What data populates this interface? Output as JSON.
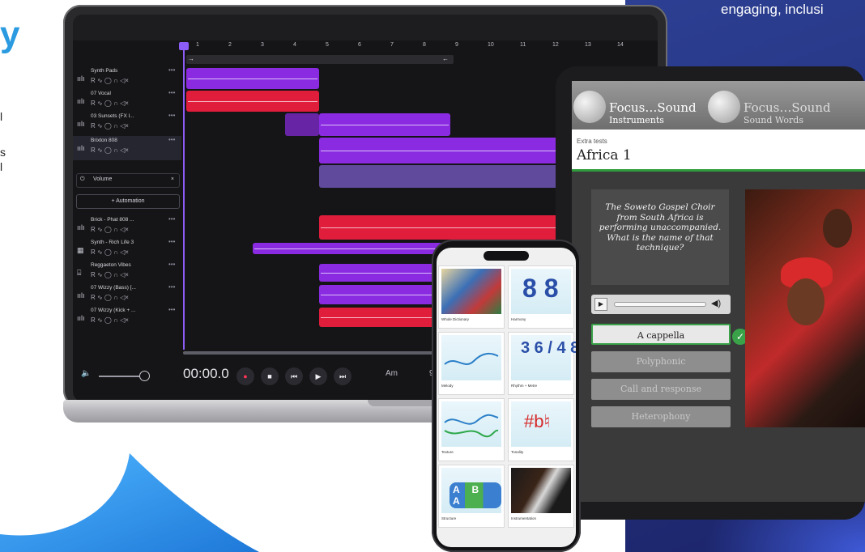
{
  "page": {
    "tagline": "engaging, inclusi",
    "headline_fragment": "y",
    "left_text_fragments": [
      "l",
      "s",
      "l"
    ],
    "colors": {
      "accent_blue": "#2a9be0",
      "panel_blue": "#2c3f92",
      "purple_clip": "#8a2be2",
      "red_clip": "#e11d3c",
      "correct_green": "#3aa34a"
    }
  },
  "daw": {
    "ruler": [
      "1",
      "2",
      "3",
      "4",
      "5",
      "6",
      "7",
      "8",
      "9",
      "10",
      "11",
      "12",
      "13",
      "14"
    ],
    "loop_arrows": {
      "start": "→",
      "end": "←"
    },
    "tracks": [
      {
        "name": "Synth Pads",
        "icon": "waveform-icon"
      },
      {
        "name": "07 Vocal",
        "icon": "waveform-icon"
      },
      {
        "name": "03 Sunsets (FX l...",
        "icon": "waveform-icon"
      },
      {
        "name": "Brixton 808",
        "icon": "waveform-icon"
      },
      {
        "name": "Brick - Phat 808 ...",
        "icon": "waveform-icon"
      },
      {
        "name": "Synth - Rich Life 3",
        "icon": "keyboard-icon"
      },
      {
        "name": "Reggaeton Vibes",
        "icon": "drum-icon"
      },
      {
        "name": "07 Wizzy (Bass) [...",
        "icon": "waveform-icon"
      },
      {
        "name": "07 Wizzy (Kick + ...",
        "icon": "waveform-icon"
      }
    ],
    "track_controls": "R  ∿  ◯  ∩  ◁×",
    "volume_label": "Volume",
    "volume_close": "×",
    "automation_button": "+ Automation",
    "transport": {
      "time": "00:00.0",
      "key": "Am",
      "bpm": "9",
      "record": "●",
      "stop": "■",
      "rewind": "⏮",
      "play": "▶",
      "forward": "⏭",
      "speaker": "🔈"
    }
  },
  "tablet": {
    "tabs": [
      {
        "brand": "Focus…Sound",
        "sub": "Instruments"
      },
      {
        "brand": "Focus…Sound",
        "sub": "Sound Words"
      }
    ],
    "kicker": "Extra tests",
    "title": "Africa 1",
    "question": "The Soweto Gospel Choir from South Africa is performing unaccompanied. What is the name of that technique?",
    "player": {
      "play": "▶",
      "speaker": "◀)"
    },
    "answers": [
      "A cappella",
      "Polyphonic",
      "Call and response",
      "Heterophony"
    ],
    "correct_mark": "✓"
  },
  "phone": {
    "tiles": [
      {
        "label": "Whole Dictionary"
      },
      {
        "label": "Harmony",
        "glyph": "8 8"
      },
      {
        "label": "Melody"
      },
      {
        "label": "Rhythm + Metre",
        "glyph": "3 6 / 4 8"
      },
      {
        "label": "Texture"
      },
      {
        "label": "Tonality",
        "glyph": "#b♮"
      },
      {
        "label": "Structure",
        "glyph": "A B A"
      },
      {
        "label": "Instrumentation"
      }
    ]
  }
}
